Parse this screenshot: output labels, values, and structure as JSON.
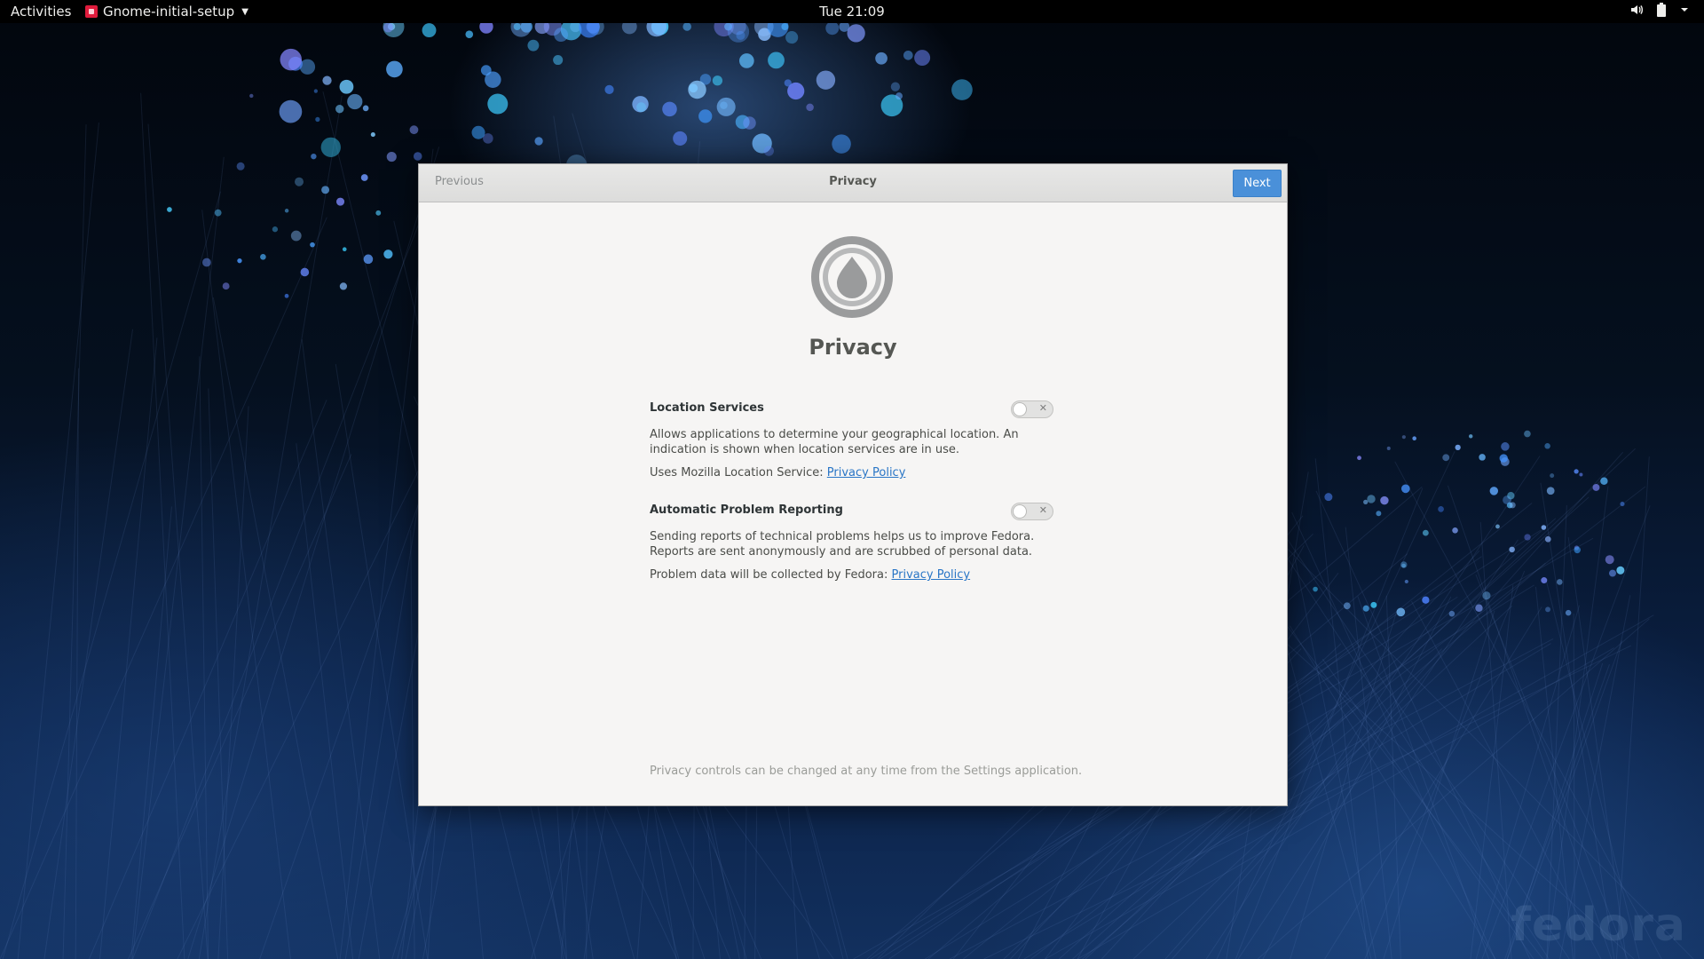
{
  "topbar": {
    "activities": "Activities",
    "app_name": "Gnome-initial-setup",
    "clock": "Tue 21:09",
    "status_icons": [
      "volume-icon",
      "battery-icon",
      "system-menu-chevron-icon"
    ]
  },
  "dialog": {
    "previous_label": "Previous",
    "header_title": "Privacy",
    "next_label": "Next",
    "page_title": "Privacy",
    "hero_icon": "privacy-icon",
    "sections": [
      {
        "label": "Location Services",
        "enabled": false,
        "description": "Allows applications to determine your geographical location. An indication is shown when location services are in use.",
        "uses_text": "Uses Mozilla Location Service: ",
        "link_text": "Privacy Policy"
      },
      {
        "label": "Automatic Problem Reporting",
        "enabled": false,
        "description": "Sending reports of technical problems helps us to improve Fedora. Reports are sent anonymously and are scrubbed of personal data.",
        "uses_text": "Problem data will be collected by Fedora: ",
        "link_text": "Privacy Policy"
      }
    ],
    "footnote": "Privacy controls can be changed at any time from the Settings application."
  },
  "wallpaper": {
    "brand_text": "fedora",
    "accent": "#4a90d9"
  }
}
